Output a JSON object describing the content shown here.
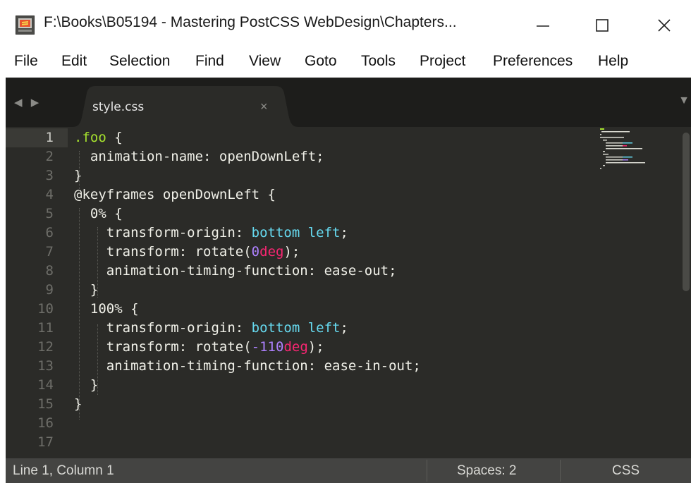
{
  "window": {
    "title": "F:\\Books\\B05194 - Mastering PostCSS WebDesign\\Chapters...",
    "minimize_glyph": "—",
    "maximize_glyph": "☐",
    "close_glyph": "✕"
  },
  "menu": [
    "File",
    "Edit",
    "Selection",
    "Find",
    "View",
    "Goto",
    "Tools",
    "Project",
    "Preferences",
    "Help"
  ],
  "tabs": {
    "nav_arrows": "◀ ▶",
    "active": {
      "label": "style.css",
      "close_glyph": "×"
    },
    "dropdown_glyph": "▼"
  },
  "editor": {
    "active_line": 1,
    "line_numbers": [
      "1",
      "2",
      "3",
      "4",
      "5",
      "6",
      "7",
      "8",
      "9",
      "10",
      "11",
      "12",
      "13",
      "14",
      "15",
      "16",
      "17"
    ],
    "lines": [
      [
        {
          "t": ".foo",
          "c": "sel"
        },
        {
          "t": " {",
          "c": "plain"
        }
      ],
      [
        {
          "t": "  animation-name: openDownLeft;",
          "c": "plain"
        }
      ],
      [
        {
          "t": "}",
          "c": "plain"
        }
      ],
      [
        {
          "t": "@keyframes openDownLeft {",
          "c": "at"
        }
      ],
      [
        {
          "t": "  0% {",
          "c": "plain"
        }
      ],
      [
        {
          "t": "    transform-origin: ",
          "c": "plain"
        },
        {
          "t": "bottom left",
          "c": "val"
        },
        {
          "t": ";",
          "c": "plain"
        }
      ],
      [
        {
          "t": "    transform: rotate(",
          "c": "plain"
        },
        {
          "t": "0",
          "c": "num"
        },
        {
          "t": "deg",
          "c": "unit"
        },
        {
          "t": ");",
          "c": "plain"
        }
      ],
      [
        {
          "t": "    animation-timing-function: ease-out;",
          "c": "plain"
        }
      ],
      [
        {
          "t": "  }",
          "c": "plain"
        }
      ],
      [
        {
          "t": "  100% {",
          "c": "plain"
        }
      ],
      [
        {
          "t": "    transform-origin: ",
          "c": "plain"
        },
        {
          "t": "bottom left",
          "c": "val"
        },
        {
          "t": ";",
          "c": "plain"
        }
      ],
      [
        {
          "t": "    transform: rotate(",
          "c": "plain"
        },
        {
          "t": "-110",
          "c": "num"
        },
        {
          "t": "deg",
          "c": "unit"
        },
        {
          "t": ");",
          "c": "plain"
        }
      ],
      [
        {
          "t": "    animation-timing-function: ease-in-out;",
          "c": "plain"
        }
      ],
      [
        {
          "t": "  }",
          "c": "plain"
        }
      ],
      [
        {
          "t": "}",
          "c": "plain"
        }
      ],
      [],
      []
    ]
  },
  "status": {
    "position": "Line 1, Column 1",
    "indentation": "Spaces: 2",
    "syntax": "CSS"
  },
  "colors": {
    "editor_bg": "#2b2b28",
    "tabbar_bg": "#1d1d1b",
    "statusbar_bg": "#444442",
    "selector": "#a6e22e",
    "value_keyword": "#66d9ef",
    "number": "#ae81ff",
    "unit": "#f92672",
    "text": "#f0f0e8"
  },
  "icons": {
    "app": "sublime-text-icon"
  }
}
